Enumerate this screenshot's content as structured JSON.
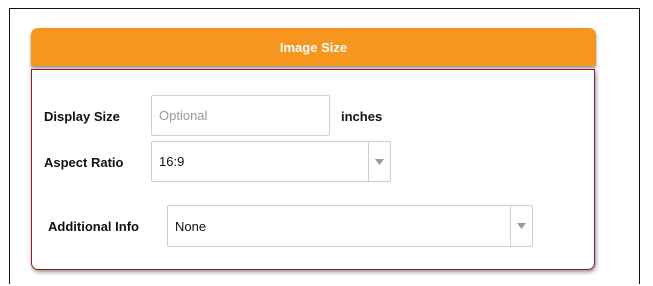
{
  "panel": {
    "title": "Image Size"
  },
  "fields": {
    "display_size": {
      "label": "Display Size",
      "placeholder": "Optional",
      "value": "",
      "unit": "inches"
    },
    "aspect_ratio": {
      "label": "Aspect Ratio",
      "selected": "16:9"
    },
    "additional_info": {
      "label": "Additional Info",
      "selected": "None"
    }
  },
  "colors": {
    "header": "#f7961e",
    "header_text": "#ffffff",
    "body_border": "#8e1b1b",
    "input_border": "#cfcfcf",
    "arrow": "#9a9a9a"
  },
  "icons": {
    "dropdown": "chevron-down-icon"
  }
}
